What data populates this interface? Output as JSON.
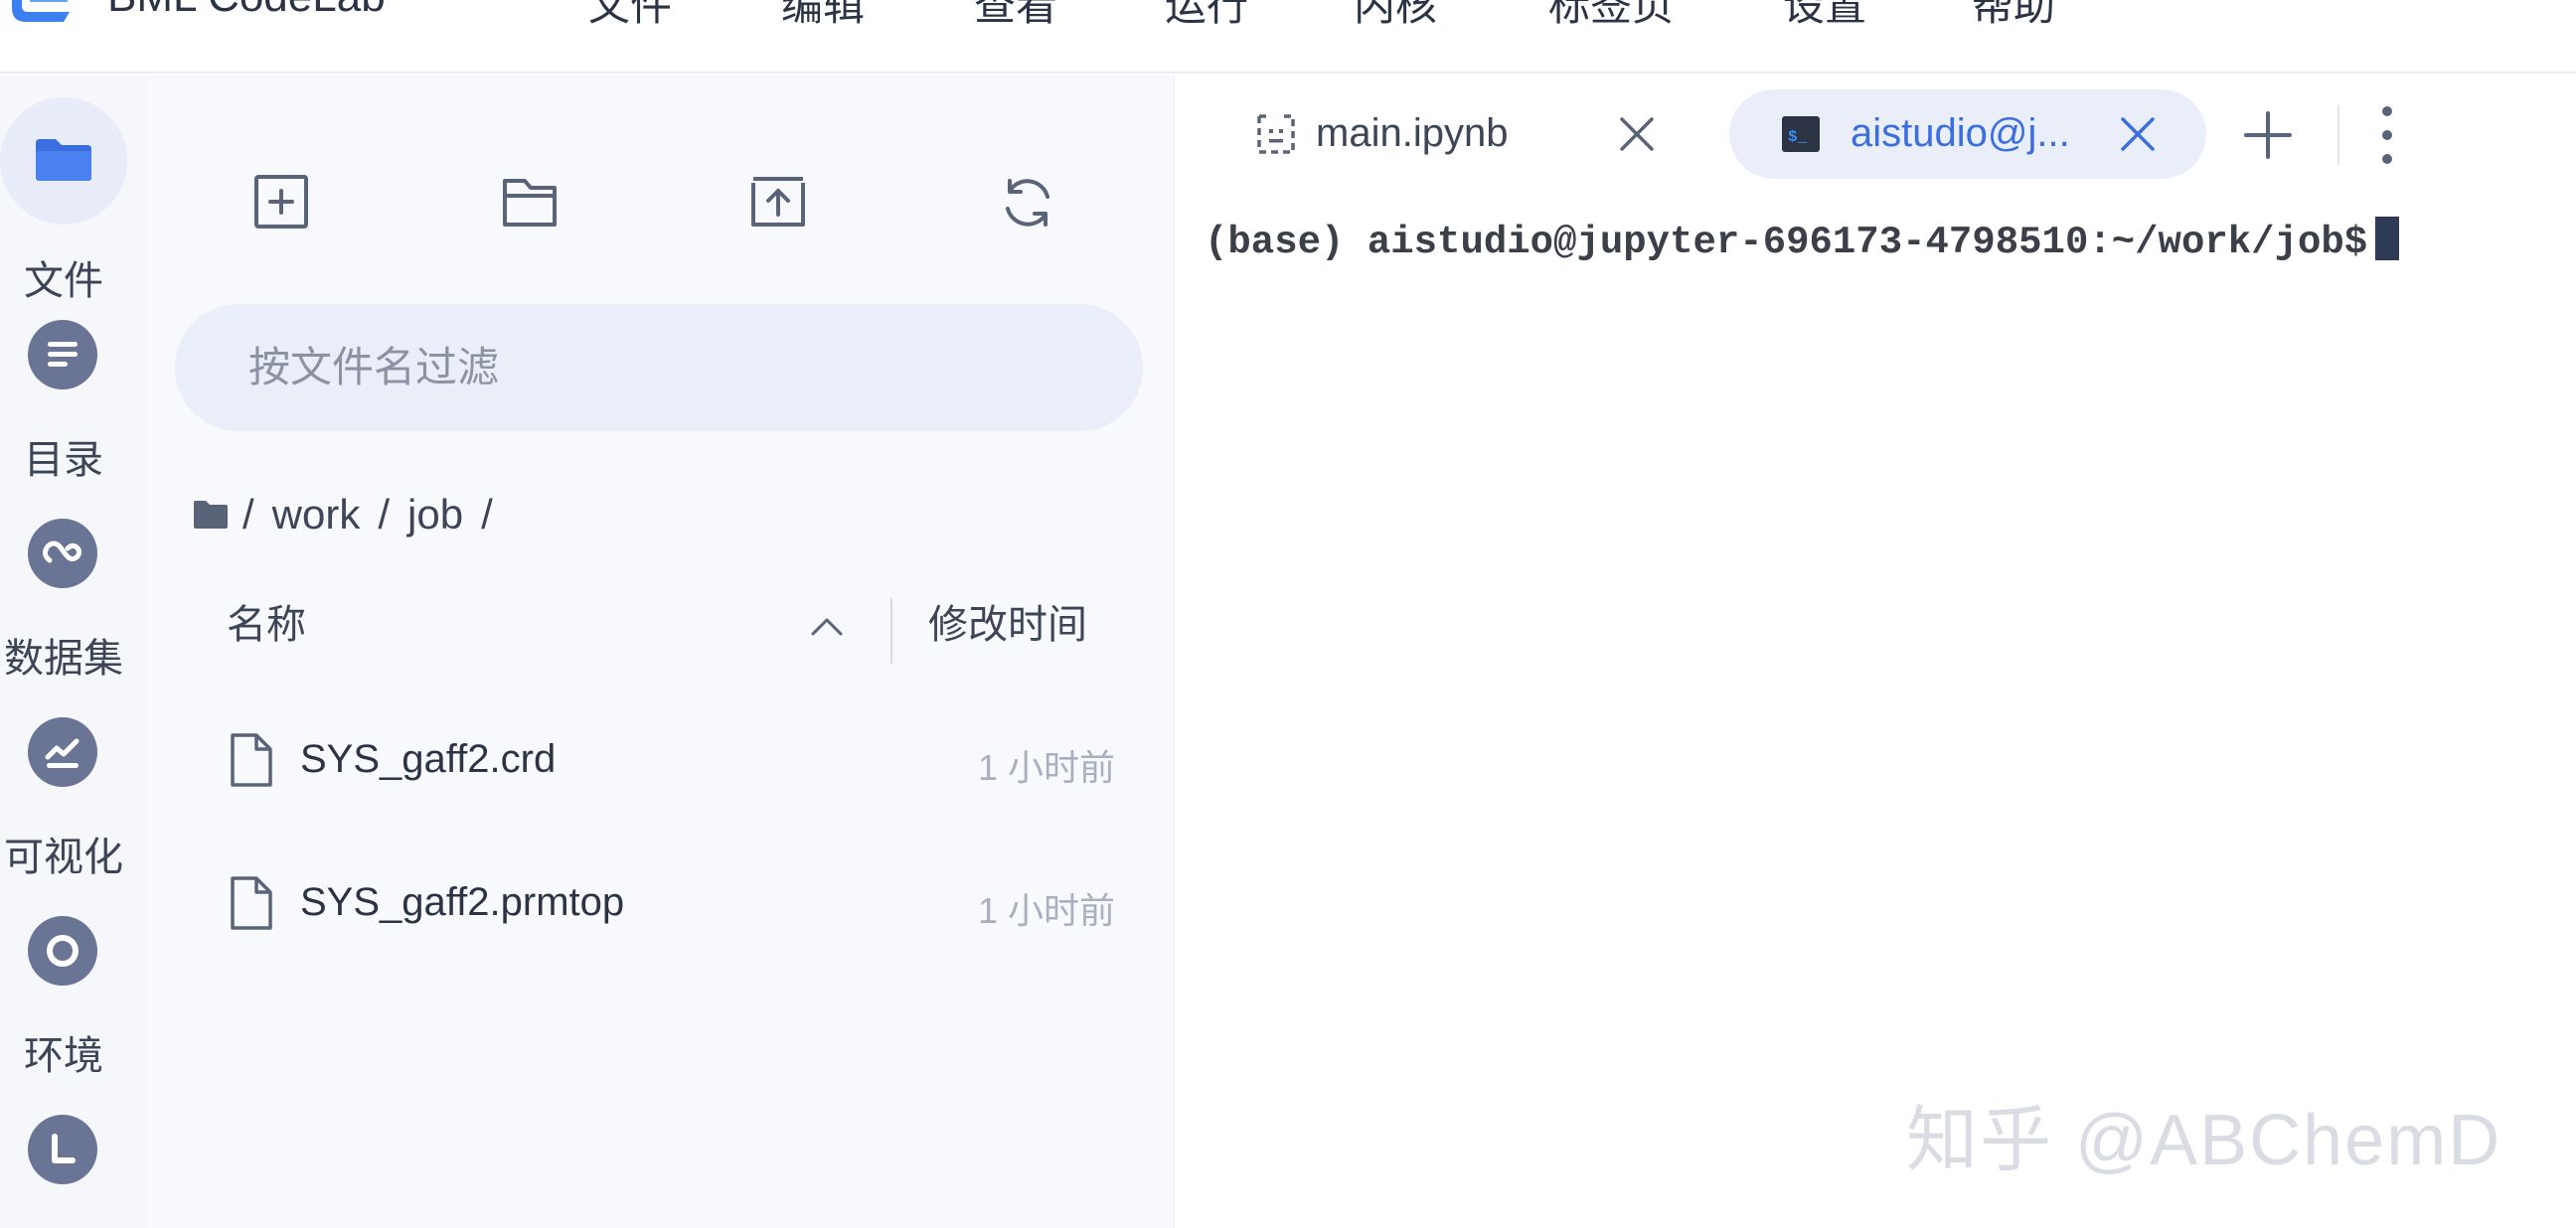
{
  "menubar": {
    "brand": "BML CodeLab",
    "items": [
      "文件",
      "编辑",
      "查看",
      "运行",
      "内核",
      "标签页",
      "设置",
      "帮助"
    ]
  },
  "sidebar": {
    "items": [
      {
        "label": "文件",
        "icon": "folder-icon"
      },
      {
        "label": "目录",
        "icon": "toc-icon"
      },
      {
        "label": "数据集",
        "icon": "dataset-icon"
      },
      {
        "label": "可视化",
        "icon": "chart-icon"
      },
      {
        "label": "环境",
        "icon": "environment-icon"
      },
      {
        "label": "",
        "icon": "log-icon"
      }
    ]
  },
  "filebrowser": {
    "toolbar": [
      "new-file-icon",
      "new-folder-icon",
      "upload-icon",
      "refresh-icon"
    ],
    "filter_placeholder": "按文件名过滤",
    "breadcrumb": [
      "/",
      "work",
      "/",
      "job",
      "/"
    ],
    "columns": {
      "name": "名称",
      "modified": "修改时间"
    },
    "files": [
      {
        "name": "SYS_gaff2.crd",
        "modified": "1 小时前"
      },
      {
        "name": "SYS_gaff2.prmtop",
        "modified": "1 小时前"
      }
    ]
  },
  "tabs": [
    {
      "label": "main.ipynb",
      "icon": "notebook-icon",
      "active": false
    },
    {
      "label": "aistudio@j...",
      "icon": "terminal-icon",
      "active": true
    }
  ],
  "terminal": {
    "prompt": "(base) aistudio@jupyter-696173-4798510:~/work/job$"
  },
  "watermark": "知乎 @ABChemD",
  "colors": {
    "accent": "#3b6fe0",
    "sidebar_icon": "#6a7596",
    "panel_bg": "#f8f9fc"
  }
}
